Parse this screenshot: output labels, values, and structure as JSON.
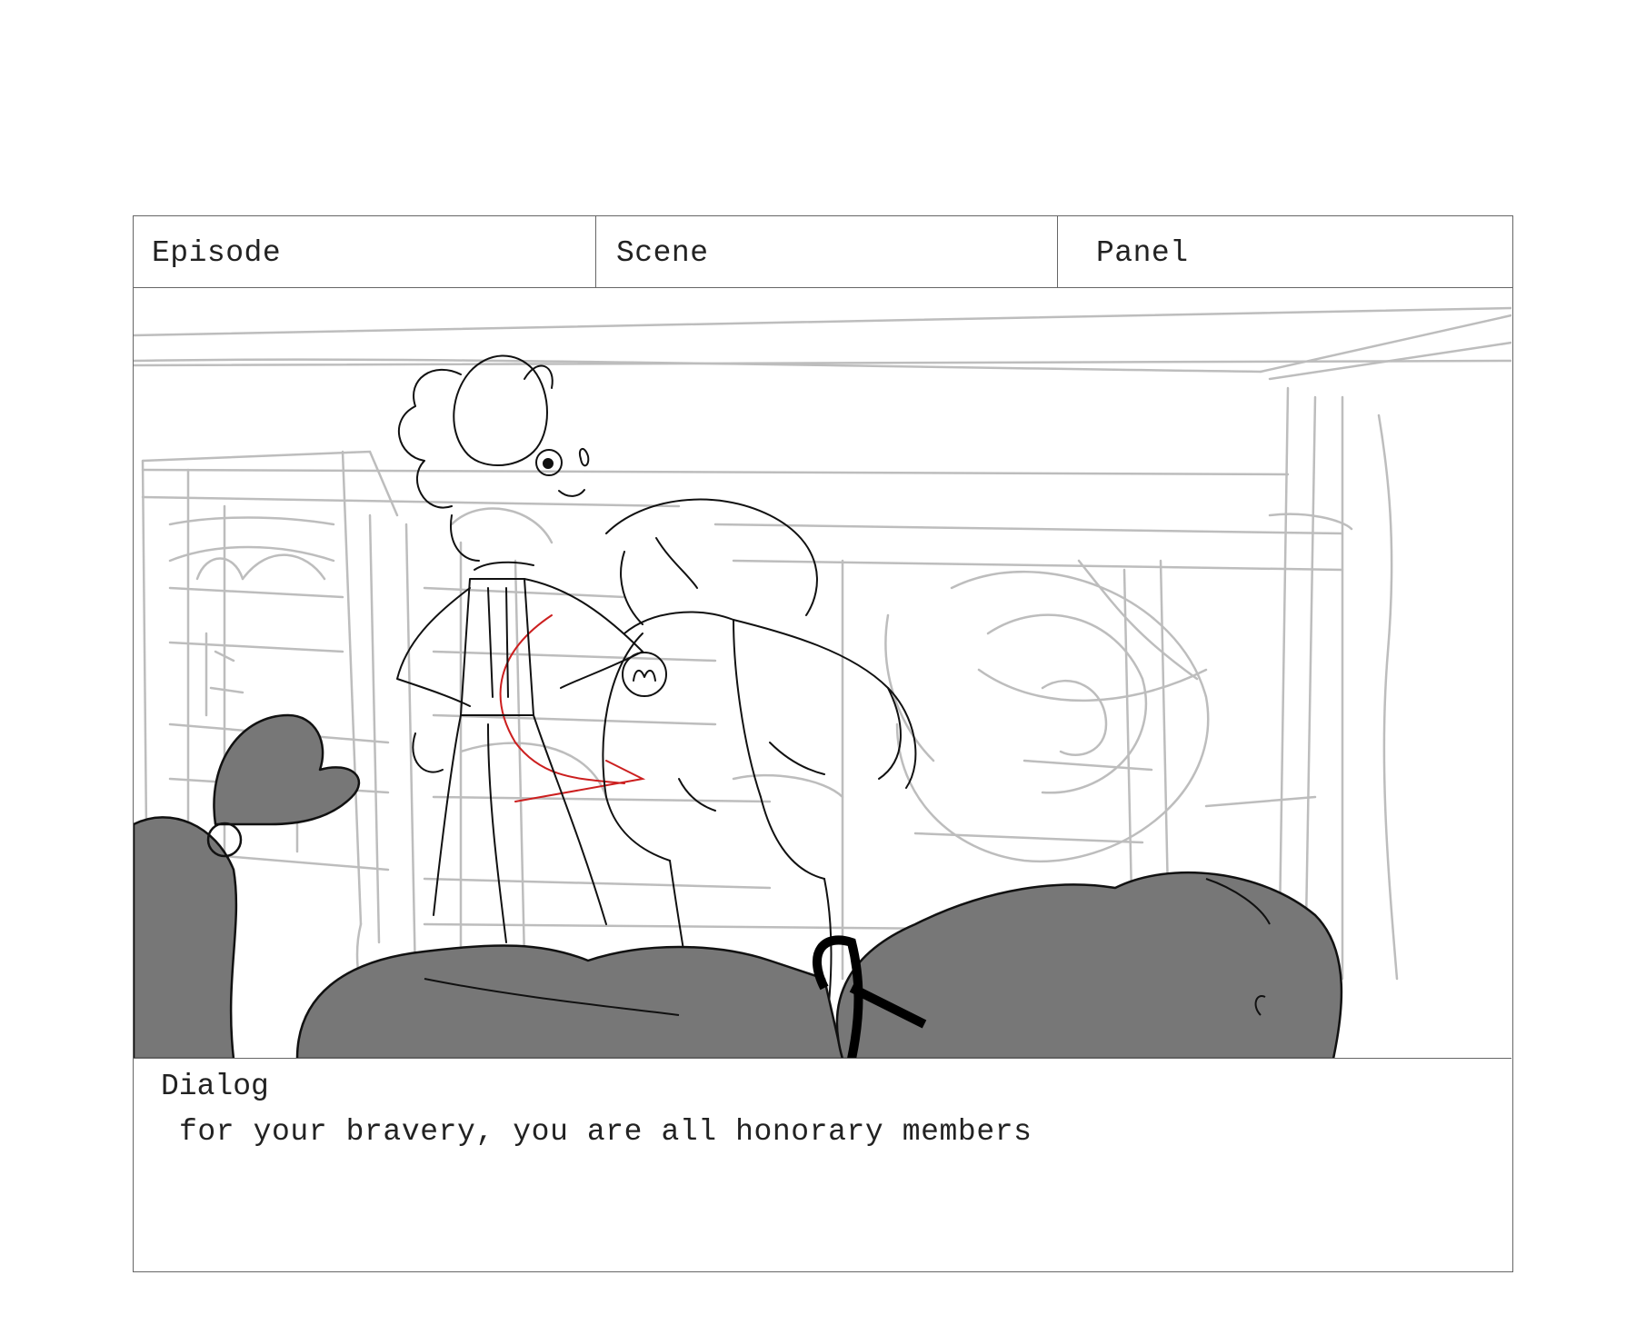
{
  "storyboard": {
    "header": {
      "episode_label": "Episode",
      "scene_label": "Scene",
      "panel_label": "Panel"
    },
    "dialog": {
      "label": "Dialog",
      "text": "for your bravery, you are all honorary members"
    },
    "colors": {
      "border": "#666666",
      "sketch_gray": "#bdbdbd",
      "silhouette": "#777777",
      "line": "#111111",
      "accent_red": "#cc1f1f"
    }
  }
}
